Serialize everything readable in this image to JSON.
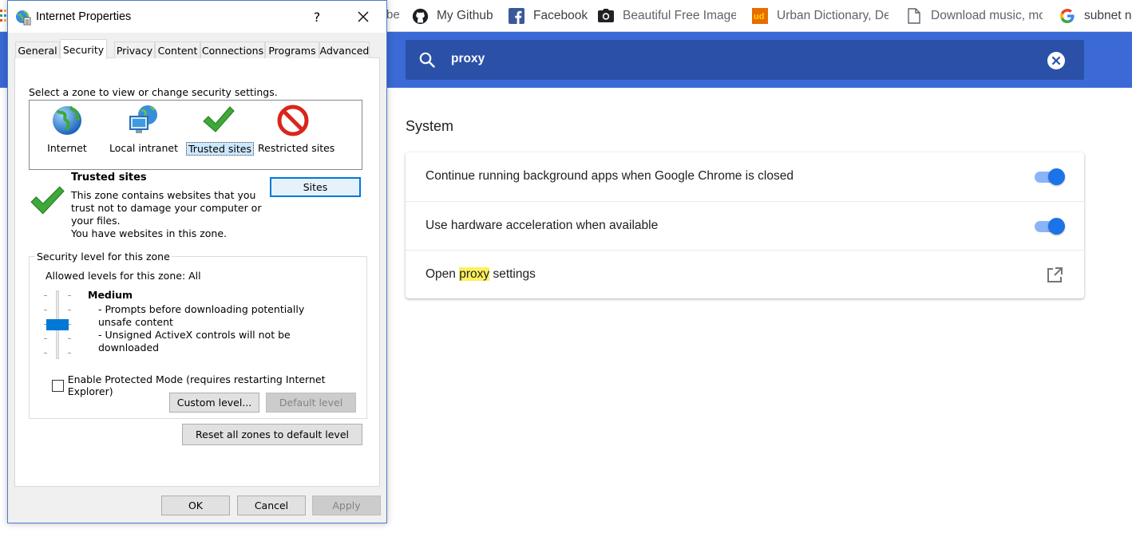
{
  "bookmarks": {
    "partial_label": "be",
    "items": [
      {
        "label": "My Github",
        "icon": "github-icon"
      },
      {
        "label": "Facebook",
        "icon": "facebook-icon"
      },
      {
        "label": "Beautiful Free Images",
        "icon": "camera-icon"
      },
      {
        "label": "Urban Dictionary, Dec",
        "icon": "urban-dictionary-icon"
      },
      {
        "label": "Download music, mo",
        "icon": "document-icon"
      },
      {
        "label": "subnet ne",
        "icon": "google-icon"
      }
    ]
  },
  "settings": {
    "search_value": "proxy",
    "section_title": "System",
    "rows": [
      {
        "label": "Continue running background apps when Google Chrome is closed",
        "control": "toggle",
        "enabled": true
      },
      {
        "label": "Use hardware acceleration when available",
        "control": "toggle",
        "enabled": true
      },
      {
        "label_before": "Open ",
        "label_highlight": "proxy",
        "label_after": " settings",
        "control": "external-link"
      }
    ],
    "colors": {
      "header": "#3b6ad6",
      "search_box": "#2a50a8",
      "toggle_on": "#1a73e8",
      "highlight": "#fdf15c"
    }
  },
  "dialog": {
    "title": "Internet Properties",
    "help_label": "?",
    "tabs": [
      "General",
      "Security",
      "Privacy",
      "Content",
      "Connections",
      "Programs",
      "Advanced"
    ],
    "active_tab": "Security",
    "zone_prompt": "Select a zone to view or change security settings.",
    "zones": [
      {
        "label": "Internet",
        "icon": "globe-icon"
      },
      {
        "label": "Local intranet",
        "icon": "intranet-icon"
      },
      {
        "label": "Trusted sites",
        "icon": "checkmark-icon",
        "selected": true
      },
      {
        "label": "Restricted sites",
        "icon": "restricted-icon"
      }
    ],
    "zone_info": {
      "title": "Trusted sites",
      "description": "This zone contains websites that you trust not to damage your computer or your files.",
      "note": "You have websites in this zone.",
      "sites_button": "Sites"
    },
    "security_group": {
      "label": "Security level for this zone",
      "allowed": "Allowed levels for this zone: All",
      "level_name": "Medium",
      "level_lines": [
        "- Prompts before downloading potentially unsafe content",
        "- Unsigned ActiveX controls will not be downloaded"
      ],
      "protected_mode": "Enable Protected Mode (requires restarting Internet Explorer)",
      "protected_mode_checked": false,
      "custom_level": "Custom level...",
      "default_level": "Default level"
    },
    "reset_all": "Reset all zones to default level",
    "footer": {
      "ok": "OK",
      "cancel": "Cancel",
      "apply": "Apply"
    }
  }
}
